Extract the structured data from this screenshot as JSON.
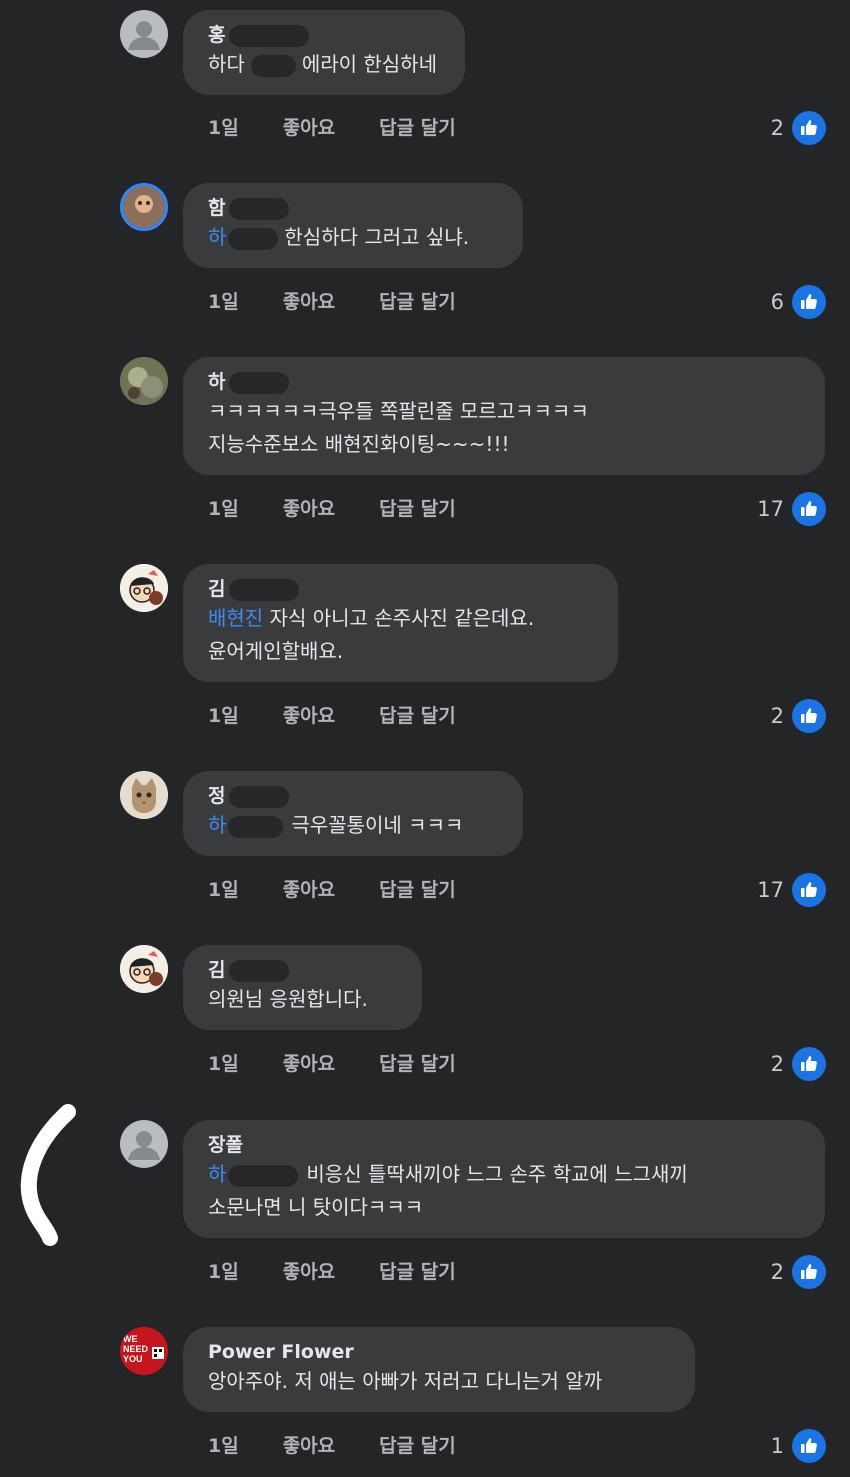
{
  "actions": {
    "time": "1일",
    "like": "좋아요",
    "reply": "답글 달기"
  },
  "comments": [
    {
      "author": "홍",
      "mention": "",
      "text_lines": [
        "하다",
        "에라이 한심하네"
      ],
      "likes": "2",
      "avatar": "default-gray"
    },
    {
      "author": "함",
      "mention": "하",
      "text_lines": [
        "한심하다 그러고 싶냐."
      ],
      "likes": "6",
      "avatar": "ring-photo"
    },
    {
      "author": "하",
      "mention": "",
      "text_lines": [
        "ㅋㅋㅋㅋㅋㅋ극우들 쪽팔린줄 모르고ㅋㅋㅋㅋ",
        "지능수준보소 배현진화이팅~~~!!!"
      ],
      "likes": "17",
      "avatar": "photo"
    },
    {
      "author": "김",
      "mention": "배현진",
      "text_lines": [
        "자식 아니고 손주사진 같은데요.",
        "윤어게인할배요."
      ],
      "likes": "2",
      "avatar": "cartoon"
    },
    {
      "author": "정",
      "mention": "하",
      "text_lines": [
        "극우꼴통이네 ㅋㅋㅋ"
      ],
      "likes": "17",
      "avatar": "cat"
    },
    {
      "author": "김",
      "mention": "",
      "text_lines": [
        "의원님 응원합니다."
      ],
      "likes": "2",
      "avatar": "cartoon"
    },
    {
      "author": "장폴",
      "mention": "하",
      "text_lines": [
        "비응신 틀딱새끼야 느그 손주 학교에 느그새끼",
        "소문나면 니 탓이다ㅋㅋㅋ"
      ],
      "likes": "2",
      "avatar": "default-gray"
    },
    {
      "author": "Power Flower",
      "mention": "",
      "text_lines": [
        "앙아주야. 저 애는 아빠가 저러고 다니는거 알까"
      ],
      "likes": "1",
      "avatar": "red-badge"
    }
  ],
  "badge_text": "WE NEED YOU"
}
